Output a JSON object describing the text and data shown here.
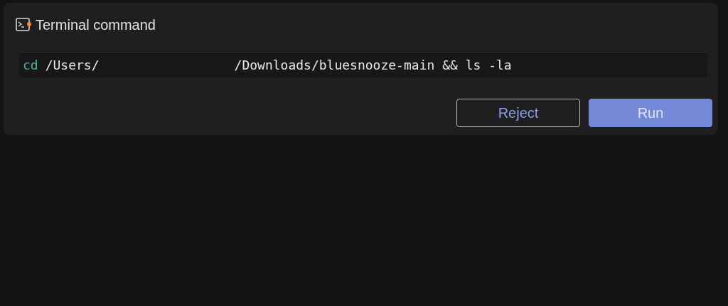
{
  "panel": {
    "title": "Terminal command",
    "notification_dot": true
  },
  "command": [
    {
      "kind": "keyword",
      "text": "cd"
    },
    {
      "kind": "text",
      "text": "/Users/"
    },
    {
      "kind": "redacted"
    },
    {
      "kind": "text",
      "text": "/Downloads/bluesnooze-main && ls -la"
    }
  ],
  "buttons": [
    {
      "kind": "secondary",
      "label": "Reject"
    },
    {
      "kind": "primary",
      "label": "Run"
    }
  ]
}
